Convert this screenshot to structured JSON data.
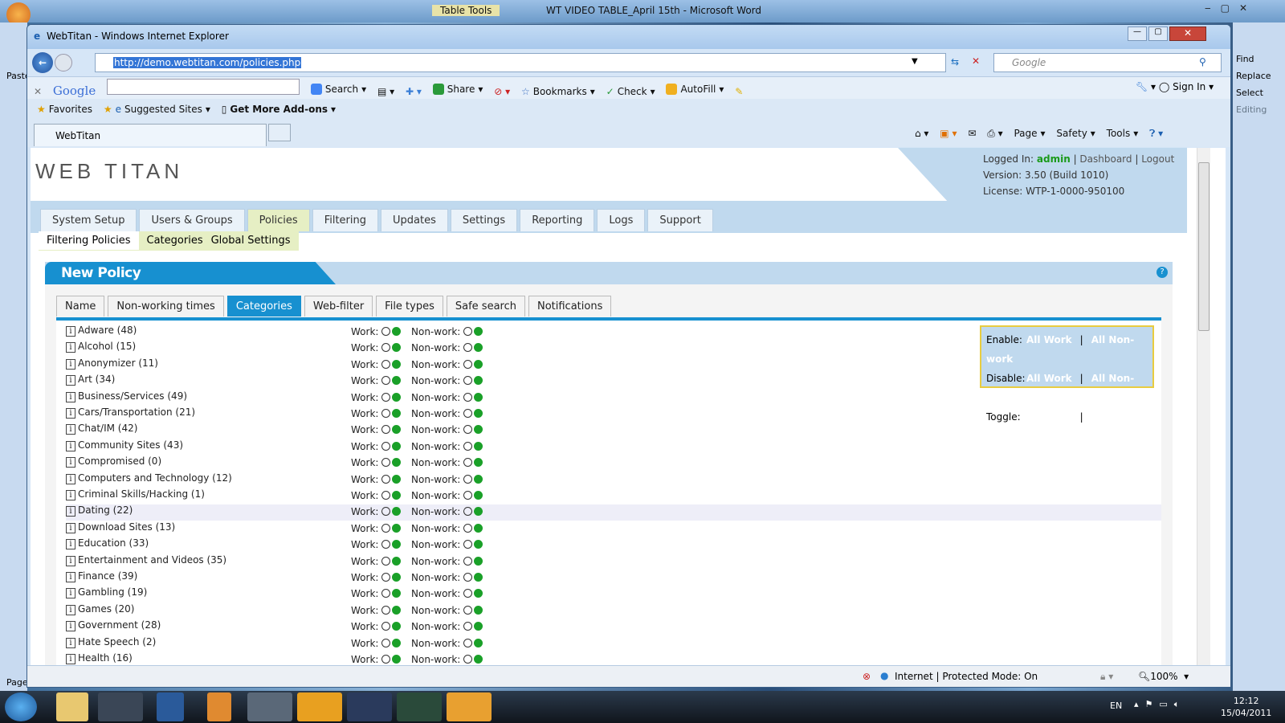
{
  "word": {
    "title": "WT VIDEO TABLE_April 15th - Microsoft Word",
    "context_tab": "Table Tools",
    "ribbon_right": [
      "Find",
      "Replace",
      "Select",
      "Editing"
    ],
    "left_label": "Paste",
    "status_left": "Page"
  },
  "ie": {
    "title": "WebTitan - Windows Internet Explorer",
    "url": "http://demo.webtitan.com/policies.php",
    "search_placeholder": "Google",
    "google_toolbar": {
      "logo": "Google",
      "search": "Search",
      "share": "Share",
      "bookmarks": "Bookmarks",
      "check": "Check",
      "autofill": "AutoFill",
      "signin": "Sign In"
    },
    "favorites": {
      "favorites": "Favorites",
      "suggested": "Suggested Sites",
      "addons": "Get More Add-ons"
    },
    "tab": "WebTitan",
    "command": {
      "page": "Page",
      "safety": "Safety",
      "tools": "Tools"
    },
    "status": {
      "zone": "Internet | Protected Mode: On",
      "zoom": "100%"
    }
  },
  "site": {
    "logo": "WEB TITAN",
    "header": {
      "logged_in_label": "Logged In:",
      "user": "admin",
      "dashboard": "Dashboard",
      "logout": "Logout",
      "version": "Version: 3.50 (Build 1010)",
      "license": "License: WTP-1-0000-950100"
    },
    "nav": [
      "System Setup",
      "Users & Groups",
      "Policies",
      "Filtering",
      "Updates",
      "Settings",
      "Reporting",
      "Logs",
      "Support"
    ],
    "nav_active": "Policies",
    "subnav": [
      "Filtering Policies",
      "Categories",
      "Global Settings"
    ],
    "panel_title": "New Policy",
    "tabs": [
      "Name",
      "Non-working times",
      "Categories",
      "Web-filter",
      "File types",
      "Safe search",
      "Notifications"
    ],
    "tab_active": "Categories",
    "work_label": "Work:",
    "nonwork_label": "Non-work:",
    "bulk": {
      "rows": [
        "Enable:",
        "Disable:",
        "Toggle:"
      ],
      "all_work": "All Work",
      "sep": "|",
      "all_nonwork": "All Non-work"
    },
    "categories": [
      {
        "name": "Adware (48)",
        "work": true,
        "nonwork": true
      },
      {
        "name": "Alcohol (15)",
        "work": true,
        "nonwork": true
      },
      {
        "name": "Anonymizer (11)",
        "work": true,
        "nonwork": true
      },
      {
        "name": "Art (34)",
        "work": true,
        "nonwork": true
      },
      {
        "name": "Business/Services (49)",
        "work": true,
        "nonwork": true
      },
      {
        "name": "Cars/Transportation (21)",
        "work": true,
        "nonwork": true
      },
      {
        "name": "Chat/IM (42)",
        "work": true,
        "nonwork": true
      },
      {
        "name": "Community Sites (43)",
        "work": true,
        "nonwork": true
      },
      {
        "name": "Compromised (0)",
        "work": true,
        "nonwork": true
      },
      {
        "name": "Computers and Technology (12)",
        "work": true,
        "nonwork": true
      },
      {
        "name": "Criminal Skills/Hacking (1)",
        "work": true,
        "nonwork": true
      },
      {
        "name": "Dating (22)",
        "work": true,
        "nonwork": true,
        "highlighted": true
      },
      {
        "name": "Download Sites (13)",
        "work": true,
        "nonwork": true
      },
      {
        "name": "Education (33)",
        "work": true,
        "nonwork": true
      },
      {
        "name": "Entertainment and Videos (35)",
        "work": true,
        "nonwork": true
      },
      {
        "name": "Finance (39)",
        "work": true,
        "nonwork": true
      },
      {
        "name": "Gambling (19)",
        "work": true,
        "nonwork": true
      },
      {
        "name": "Games (20)",
        "work": true,
        "nonwork": true
      },
      {
        "name": "Government (28)",
        "work": true,
        "nonwork": true
      },
      {
        "name": "Hate Speech (2)",
        "work": true,
        "nonwork": true
      },
      {
        "name": "Health (16)",
        "work": true,
        "nonwork": true
      }
    ]
  },
  "taskbar": {
    "lang": "EN",
    "time": "12:12",
    "date": "15/04/2011"
  },
  "colors": {
    "accent": "#1790d0",
    "enabled": "#1aa028",
    "user": "#1a9a1a",
    "header_blue": "#c0d9ee"
  }
}
